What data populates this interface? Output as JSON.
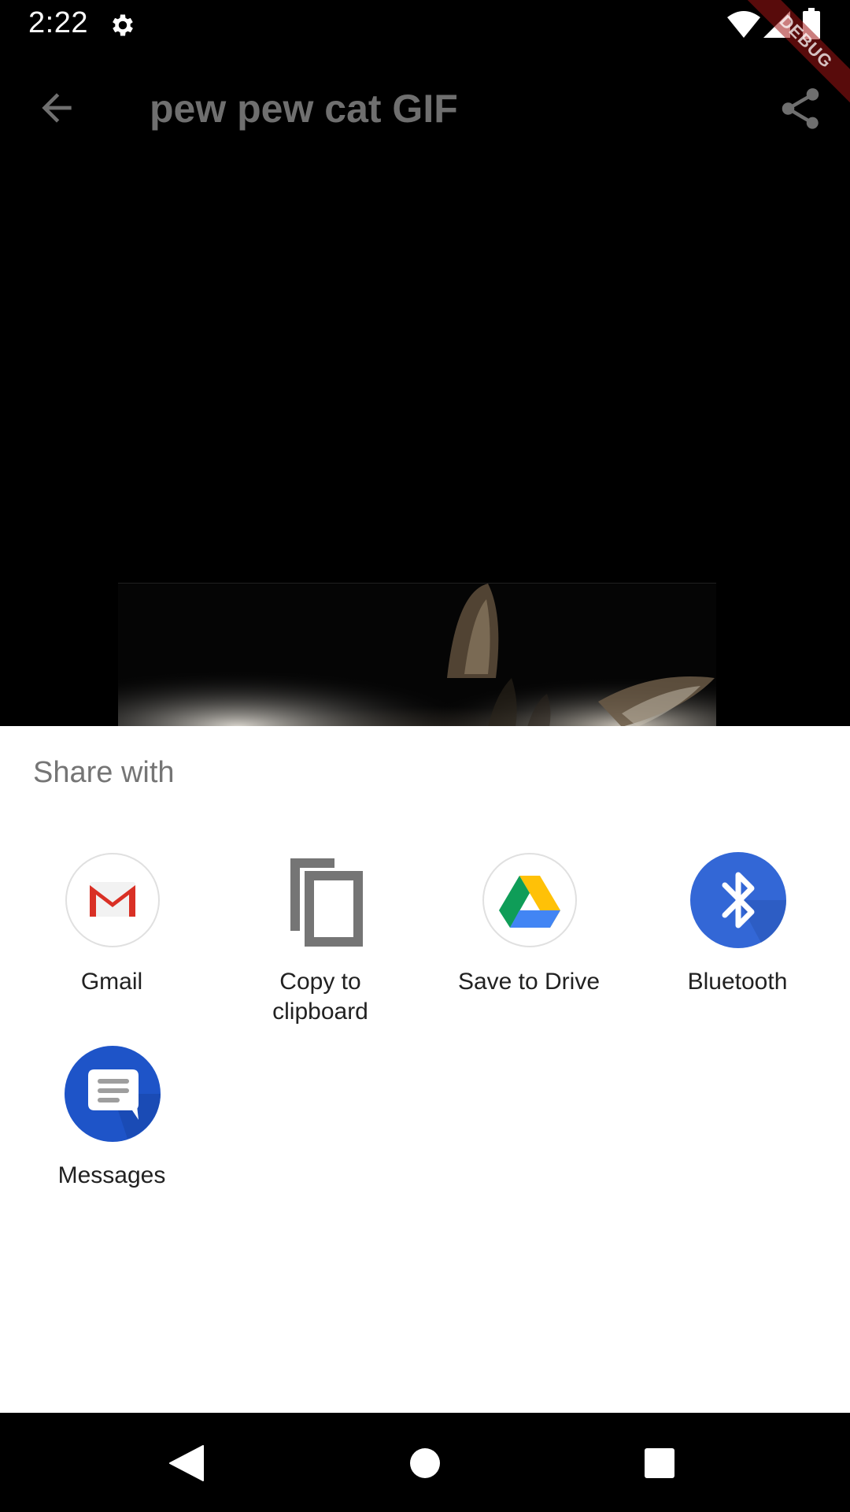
{
  "status_bar": {
    "time": "2:22",
    "icons": [
      "gear-icon",
      "wifi-icon",
      "cell-signal-icon",
      "battery-icon"
    ]
  },
  "debug_banner": "DEBUG",
  "app_bar": {
    "title": "pew pew cat GIF",
    "back_icon": "arrow-back-icon",
    "share_icon": "share-icon"
  },
  "share_sheet": {
    "title": "Share with",
    "targets": [
      {
        "label": "Gmail",
        "icon": "gmail-icon"
      },
      {
        "label": "Copy to\nclipboard",
        "icon": "copy-icon"
      },
      {
        "label": "Save to Drive",
        "icon": "drive-icon"
      },
      {
        "label": "Bluetooth",
        "icon": "bluetooth-icon"
      },
      {
        "label": "Messages",
        "icon": "messages-icon"
      }
    ]
  },
  "nav_bar": {
    "icons": [
      "nav-back-icon",
      "nav-home-icon",
      "nav-recents-icon"
    ]
  },
  "colors": {
    "bluetooth": "#3367D6",
    "messages": "#1E54C8",
    "gmail_red": "#D93025",
    "sheet_title": "#757575"
  }
}
